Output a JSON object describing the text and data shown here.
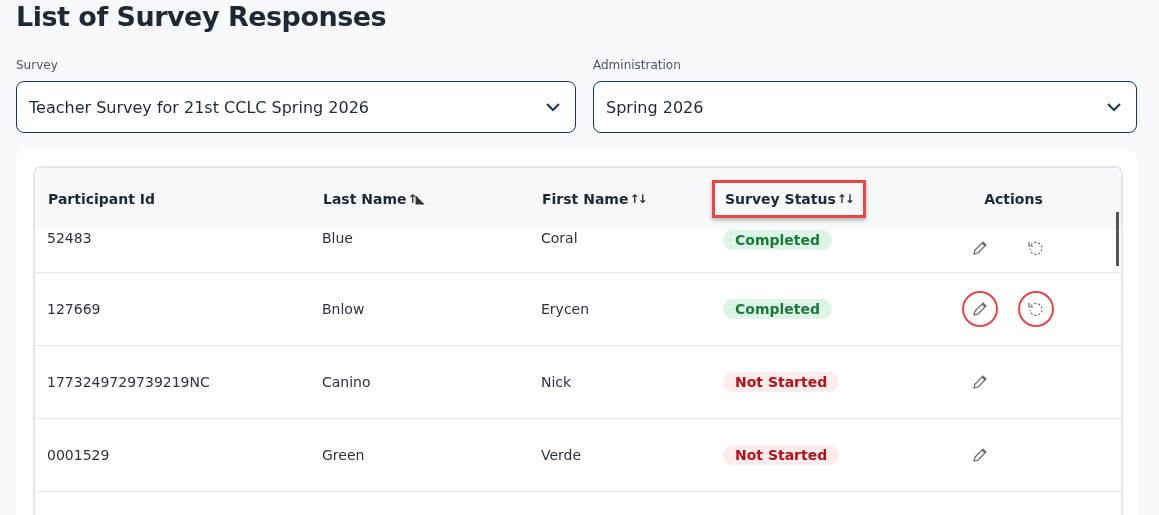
{
  "title": "List of Survey Responses",
  "filters": [
    {
      "label": "Survey",
      "value": "Teacher Survey for 21st CCLC Spring 2026"
    },
    {
      "label": "Administration",
      "value": "Spring 2026"
    }
  ],
  "table": {
    "columns": [
      {
        "label": "Participant Id",
        "highlighted": false
      },
      {
        "label": "Last Name",
        "sort_icon": "↑◣",
        "highlighted": false
      },
      {
        "label": "First Name",
        "sort_icon": "↑↓",
        "highlighted": false
      },
      {
        "label": "Survey Status",
        "sort_icon": "↑↓",
        "highlighted": true
      },
      {
        "label": "Actions",
        "highlighted": false
      }
    ],
    "rows": [
      {
        "participant_id": "52483",
        "last_name": "Blue",
        "first_name": "Coral",
        "status": {
          "text": "Completed",
          "kind": "completed"
        },
        "actions": [
          {
            "kind": "edit",
            "highlighted": false
          },
          {
            "kind": "reset",
            "highlighted": false
          }
        ],
        "partial": true
      },
      {
        "participant_id": "127669",
        "last_name": "Bnlow",
        "first_name": "Erycen",
        "status": {
          "text": "Completed",
          "kind": "completed"
        },
        "actions": [
          {
            "kind": "edit",
            "highlighted": true
          },
          {
            "kind": "reset",
            "highlighted": true
          }
        ],
        "partial": false
      },
      {
        "participant_id": "1773249729739219NC",
        "last_name": "Canino",
        "first_name": "Nick",
        "status": {
          "text": "Not Started",
          "kind": "not_started"
        },
        "actions": [
          {
            "kind": "edit",
            "highlighted": false
          }
        ],
        "partial": false
      },
      {
        "participant_id": "0001529",
        "last_name": "Green",
        "first_name": "Verde",
        "status": {
          "text": "Not Started",
          "kind": "not_started"
        },
        "actions": [
          {
            "kind": "edit",
            "highlighted": false
          }
        ],
        "partial": false
      }
    ]
  }
}
